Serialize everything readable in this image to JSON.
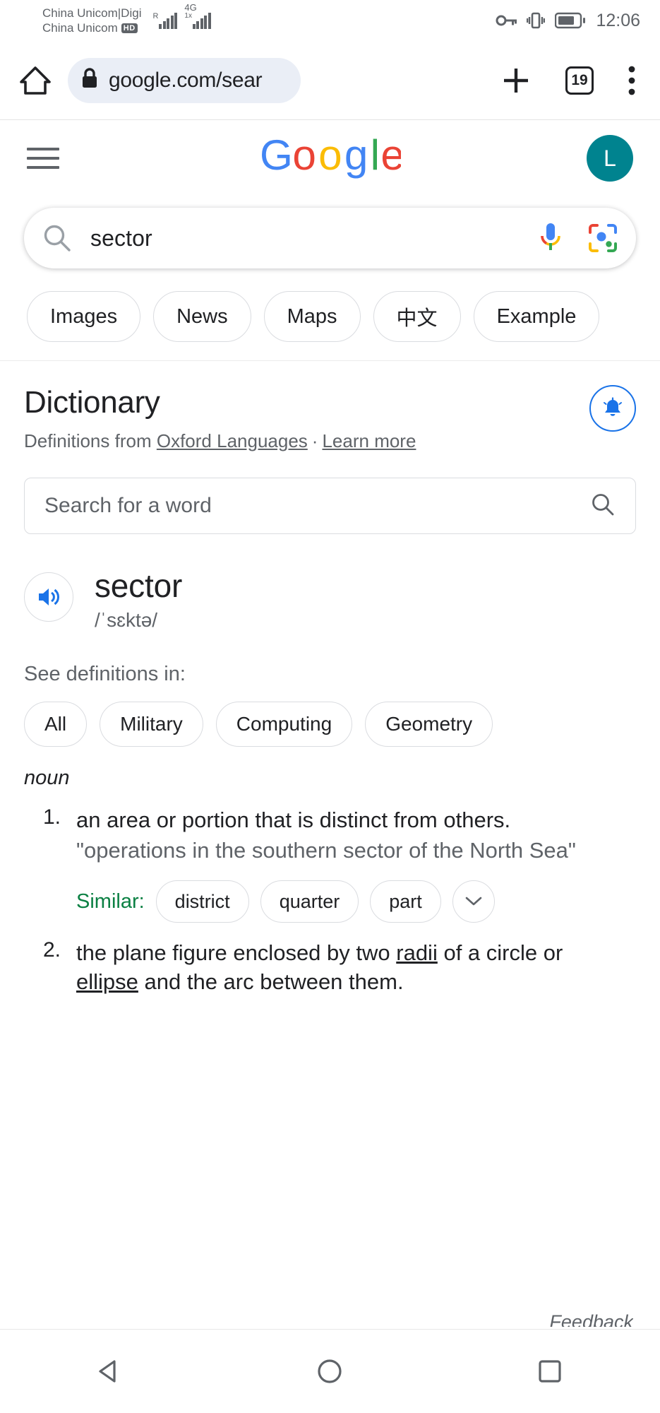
{
  "statusbar": {
    "carrier_line1": "China Unicom|Digi",
    "carrier_line2": "China Unicom",
    "hd_badge": "HD",
    "roaming_label": "R",
    "network_label": "4G",
    "network_sub": "1x",
    "clock": "12:06",
    "icons": [
      "vpn-key-icon",
      "vibrate-icon",
      "battery-icon"
    ]
  },
  "browser": {
    "home_icon": "home-icon",
    "lock_icon": "lock-icon",
    "url": "google.com/sear",
    "new_tab_icon": "plus-icon",
    "tab_count": "19",
    "menu_icon": "more-vertical-icon"
  },
  "google_header": {
    "menu_icon": "hamburger-menu-icon",
    "logo": "Google",
    "logo_letters": [
      "G",
      "o",
      "o",
      "g",
      "l",
      "e"
    ],
    "logo_colors": [
      "#4285F4",
      "#EA4335",
      "#FBBC05",
      "#4285F4",
      "#34A853",
      "#EA4335"
    ],
    "avatar_initial": "L",
    "avatar_color": "#00838f"
  },
  "search": {
    "query": "sector",
    "search_icon": "search-icon",
    "mic_icon": "microphone-icon",
    "lens_icon": "google-lens-icon"
  },
  "filter_chips": [
    {
      "label": "Images"
    },
    {
      "label": "News"
    },
    {
      "label": "Maps"
    },
    {
      "label": "中文"
    },
    {
      "label": "Example"
    }
  ],
  "dictionary": {
    "title": "Dictionary",
    "source_prefix": "Definitions from",
    "source_link": "Oxford Languages",
    "separator": "·",
    "learn_more": "Learn more",
    "notify_icon": "bell-icon",
    "word_search_placeholder": "Search for a word",
    "word_search_icon": "search-icon",
    "speaker_icon": "speaker-icon",
    "headword": "sector",
    "phonetic": "/ˈsɛktə/",
    "see_definitions_label": "See definitions in:",
    "sense_chips": [
      {
        "label": "All"
      },
      {
        "label": "Military"
      },
      {
        "label": "Computing"
      },
      {
        "label": "Geometry"
      }
    ],
    "part_of_speech": "noun",
    "definitions": [
      {
        "number": "1.",
        "text": "an area or portion that is distinct from others.",
        "example": "\"operations in the southern sector of the North Sea\"",
        "similar_label": "Similar:",
        "synonyms": [
          "district",
          "quarter",
          "part"
        ],
        "more_icon": "chevron-down-icon"
      },
      {
        "number": "2.",
        "text_parts": [
          {
            "t": "the plane figure enclosed by two ",
            "u": false
          },
          {
            "t": "radii",
            "u": true
          },
          {
            "t": " of a circle or ",
            "u": false
          },
          {
            "t": "ellipse",
            "u": true
          },
          {
            "t": " and the arc between them.",
            "u": false
          }
        ],
        "text": "the plane figure enclosed by two radii of a circle or ellipse and the arc between them."
      }
    ],
    "peek_text": "Feedback"
  },
  "navbar": {
    "back_icon": "triangle-back-icon",
    "home_icon": "circle-home-icon",
    "recents_icon": "square-recents-icon"
  }
}
